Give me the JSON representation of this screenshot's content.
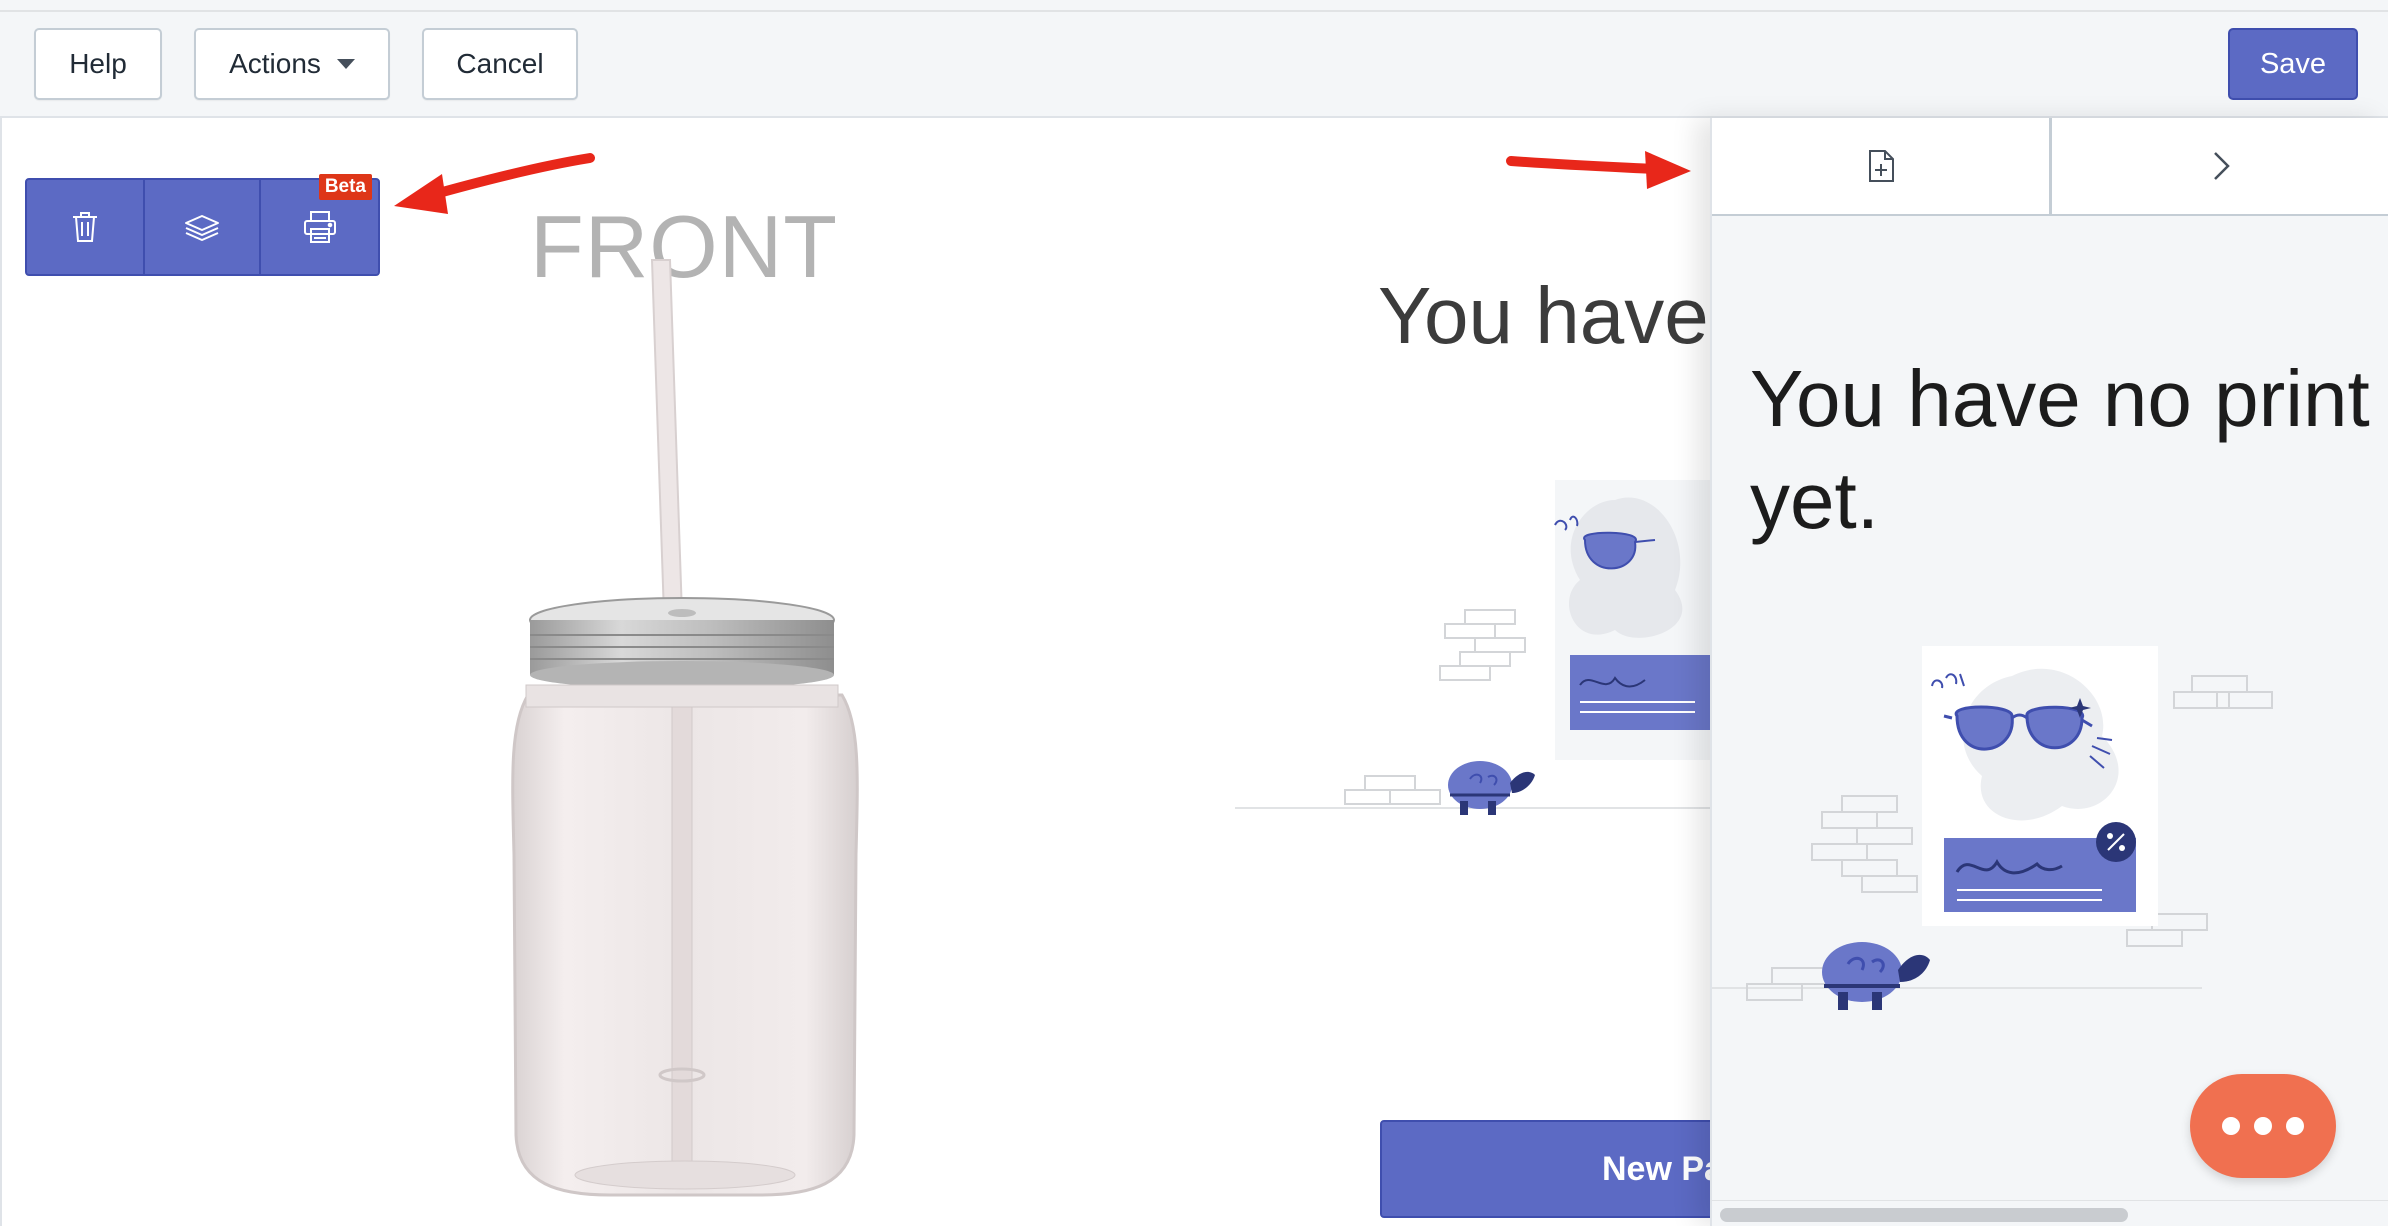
{
  "toolbar": {
    "help_label": "Help",
    "actions_label": "Actions",
    "cancel_label": "Cancel",
    "save_label": "Save"
  },
  "tools": {
    "beta_badge": "Beta",
    "icons": [
      "trash-icon",
      "layers-icon",
      "printer-icon"
    ]
  },
  "canvas": {
    "side_label": "FRONT"
  },
  "background_empty_state": {
    "title": "You have",
    "button_label": "New Pa"
  },
  "panel": {
    "tabs": [
      "add-file-icon",
      "chevron-right-icon"
    ],
    "empty_title": "You have no print",
    "empty_title_line2": "yet."
  },
  "colors": {
    "primary": "#5c6ac4",
    "primary_border": "#3f4eae",
    "beta": "#de3618",
    "annotation_arrow": "#e8271a",
    "chat": "#f07050"
  }
}
